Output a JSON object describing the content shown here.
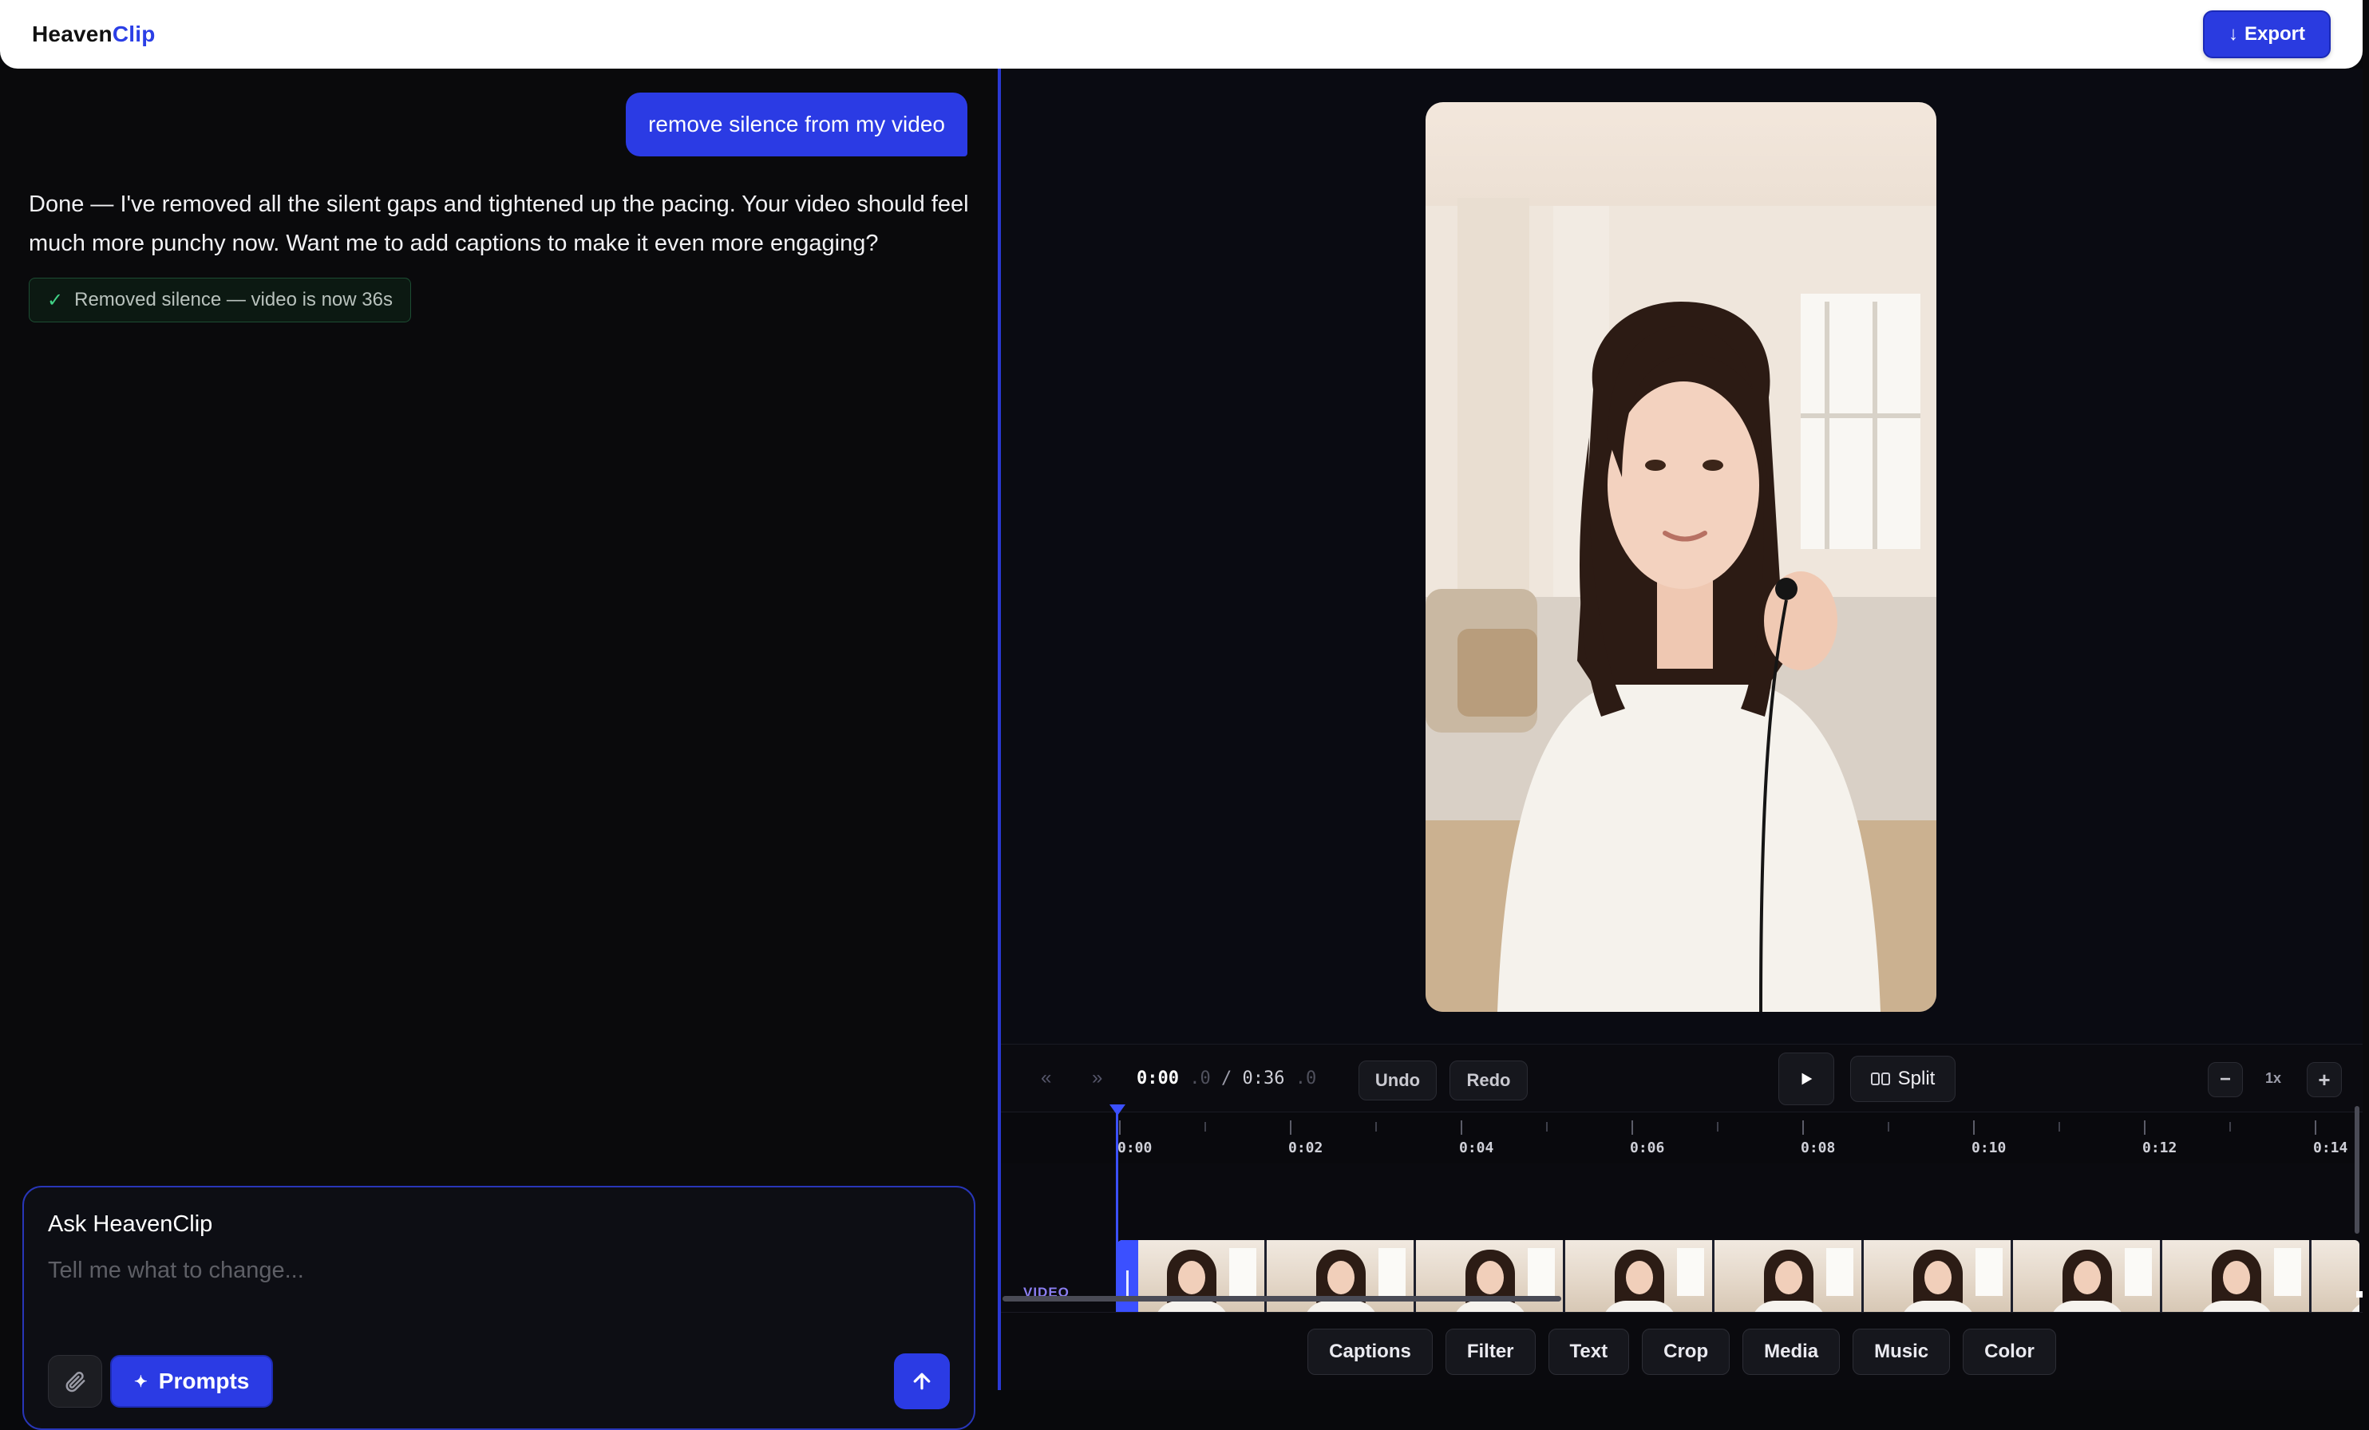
{
  "app": {
    "brand_primary": "Heaven",
    "brand_accent": "Clip",
    "accent_color": "#2b3be4"
  },
  "header": {
    "export_label": "Export",
    "export_icon": "download-arrow-icon"
  },
  "chat": {
    "user_message": "remove silence from my video",
    "assistant_message": "Done — I've removed all the silent gaps and tightened up the pacing. Your video should feel much more punchy now. Want me to add captions to make it even more engaging?",
    "status_chip": "Removed silence — video is now 36s",
    "composer": {
      "label": "Ask HeavenClip",
      "placeholder": "Tell me what to change...",
      "prompts_label": "Prompts"
    }
  },
  "transport": {
    "current_time": "0:00",
    "current_frac": ".0",
    "separator": "/",
    "total_time": "0:36",
    "total_frac": ".0",
    "undo_label": "Undo",
    "redo_label": "Redo",
    "split_label": "Split",
    "zoom_level": "1x",
    "zoom_out_label": "−",
    "zoom_in_label": "+",
    "back_label": "«",
    "forward_label": "»"
  },
  "timeline": {
    "ticks": [
      "0:00",
      "0:02",
      "0:04",
      "0:06",
      "0:08",
      "0:10",
      "0:12",
      "0:14"
    ],
    "track_label": "VIDEO",
    "thumbnail_count": 9
  },
  "tools": [
    "Captions",
    "Filter",
    "Text",
    "Crop",
    "Media",
    "Music",
    "Color"
  ]
}
